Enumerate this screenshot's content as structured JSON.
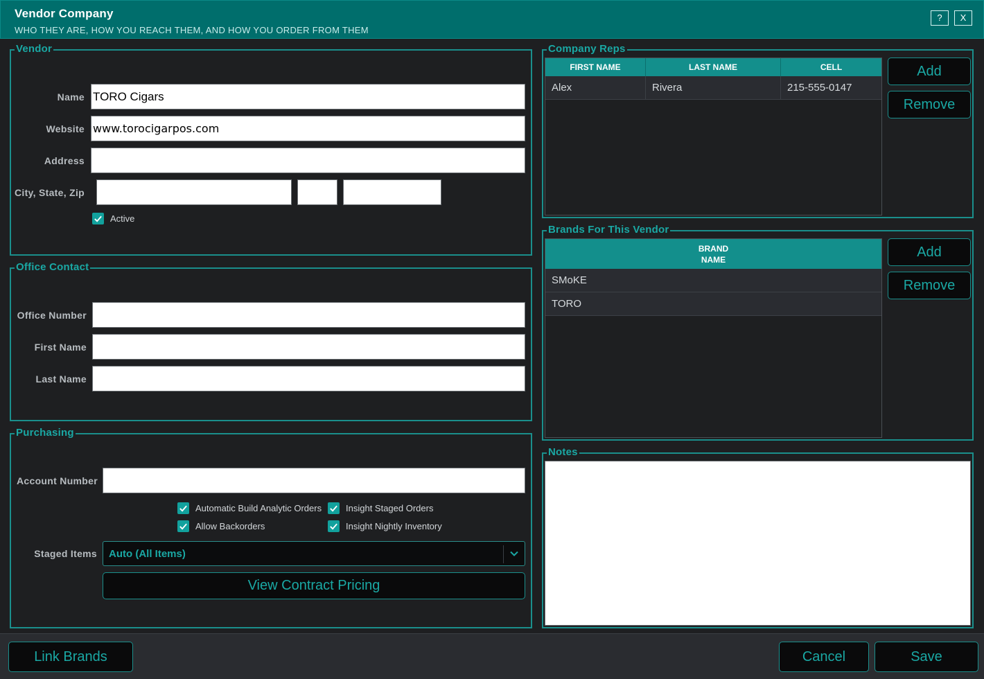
{
  "window": {
    "title": "Vendor Company",
    "subtitle": "WHO THEY ARE, HOW YOU REACH THEM, AND HOW YOU ORDER FROM THEM",
    "help_label": "?",
    "close_label": "X"
  },
  "vendor": {
    "legend": "Vendor",
    "name_label": "Name",
    "name_value": "TORO Cigars",
    "website_label": "Website",
    "website_value": "www.torocigarpos.com",
    "address_label": "Address",
    "address_value": "",
    "city_state_zip_label": "City, State, Zip",
    "city_value": "",
    "state_value": "",
    "zip_value": "",
    "active_label": "Active",
    "active_checked": true
  },
  "office_contact": {
    "legend": "Office Contact",
    "office_number_label": "Office Number",
    "office_number_value": "",
    "first_name_label": "First Name",
    "first_name_value": "",
    "last_name_label": "Last Name",
    "last_name_value": ""
  },
  "purchasing": {
    "legend": "Purchasing",
    "account_number_label": "Account Number",
    "account_number_value": "",
    "options": {
      "auto_build": "Automatic Build Analytic Orders",
      "allow_backorders": "Allow Backorders",
      "insight_staged": "Insight Staged Orders",
      "insight_nightly": "Insight Nightly Inventory"
    },
    "staged_items_label": "Staged Items",
    "staged_items_value": "Auto (All Items)",
    "contract_pricing_label": "View Contract Pricing"
  },
  "company_reps": {
    "legend": "Company Reps",
    "columns": [
      "FIRST NAME",
      "LAST NAME",
      "CELL"
    ],
    "rows": [
      {
        "first": "Alex",
        "last": "Rivera",
        "cell": "215-555-0147"
      }
    ],
    "add_label": "Add",
    "remove_label": "Remove"
  },
  "brands": {
    "legend": "Brands For This Vendor",
    "column_line1": "BRAND",
    "column_line2": "NAME",
    "rows": [
      "SMoKE",
      "TORO"
    ],
    "add_label": "Add",
    "remove_label": "Remove"
  },
  "notes": {
    "legend": "Notes",
    "value": ""
  },
  "footer": {
    "link_brands_label": "Link Brands",
    "cancel_label": "Cancel",
    "save_label": "Save"
  },
  "colors": {
    "accent": "#1aa8a4",
    "titlebar": "#006e6c",
    "background": "#1e1f21"
  }
}
